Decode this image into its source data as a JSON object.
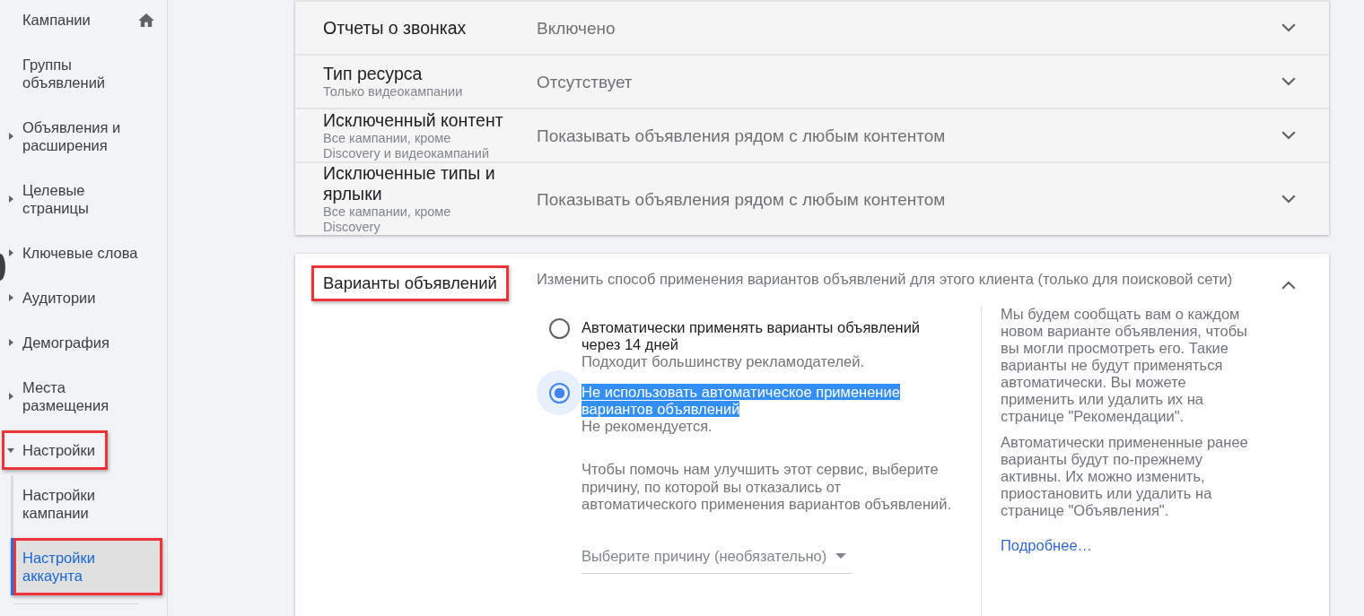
{
  "sidebar": {
    "items": [
      {
        "label": "Кампании",
        "kind": "home",
        "selected": false,
        "annotated": false
      },
      {
        "label": "Группы объявлений",
        "kind": "plain",
        "selected": false,
        "annotated": false
      },
      {
        "label": "Объявления и расширения",
        "kind": "collapsible",
        "expanded": false,
        "selected": false,
        "annotated": false
      },
      {
        "label": "Целевые страницы",
        "kind": "collapsible",
        "expanded": false,
        "selected": false,
        "annotated": false
      },
      {
        "label": "Ключевые слова",
        "kind": "collapsible",
        "expanded": false,
        "selected": false,
        "annotated": false
      },
      {
        "label": "Аудитории",
        "kind": "collapsible",
        "expanded": false,
        "selected": false,
        "annotated": false
      },
      {
        "label": "Демография",
        "kind": "collapsible",
        "expanded": false,
        "selected": false,
        "annotated": false
      },
      {
        "label": "Места размещения",
        "kind": "collapsible",
        "expanded": false,
        "selected": false,
        "annotated": false
      },
      {
        "label": "Настройки",
        "kind": "collapsible",
        "expanded": true,
        "selected": false,
        "annotated": true,
        "children": [
          {
            "label": "Настройки кампании",
            "selected": false,
            "annotated": false
          },
          {
            "label": "Настройки аккаунта",
            "selected": true,
            "annotated": true
          }
        ]
      }
    ]
  },
  "settings_rows": [
    {
      "label": "Отчеты о звонках",
      "value": "Включено",
      "expanded": false
    },
    {
      "label": "Тип ресурса",
      "note": "Только видеокампании",
      "value": "Отсутствует",
      "expanded": false
    },
    {
      "label": "Исключенный контент",
      "note": "Все кампании, кроме Discovery и видеокампаний",
      "value": "Показывать объявления рядом с любым контентом",
      "expanded": false
    },
    {
      "label": "Исключенные типы и ярлыки",
      "note": "Все кампании, кроме Discovery",
      "value": "Показывать объявления рядом с любым контентом",
      "expanded": false
    }
  ],
  "ad_variants": {
    "title": "Варианты объявлений",
    "annotated": true,
    "description": "Изменить способ применения вариантов объявлений для этого клиента (только для поисковой сети)",
    "expanded": true,
    "options": [
      {
        "label": "Автоматически применять варианты объявлений через 14 дней",
        "hint": "Подходит большинству рекламодателей.",
        "selected": false,
        "highlighted": false
      },
      {
        "label": "Не использовать автоматическое применение вариантов объявлений",
        "hint": "Не рекомендуется.",
        "selected": true,
        "highlighted": true
      }
    ],
    "reason_prompt": "Чтобы помочь нам улучшить этот сервис, выберите причину, по которой вы отказались от автоматического применения вариантов объявлений.",
    "reason_select": {
      "placeholder": "Выберите причину (необязательно)"
    },
    "info": [
      "Мы будем сообщать вам о каждом новом варианте объявления, чтобы вы могли просмотреть его. Такие варианты не будут применяться автоматически. Вы можете применить или удалить их на странице \"Рекомендации\".",
      "Автоматически примененные ранее варианты будут по-прежнему активны. Их можно изменить, приостановить или удалить на странице \"Объявления\"."
    ],
    "link": "Подробнее…"
  }
}
